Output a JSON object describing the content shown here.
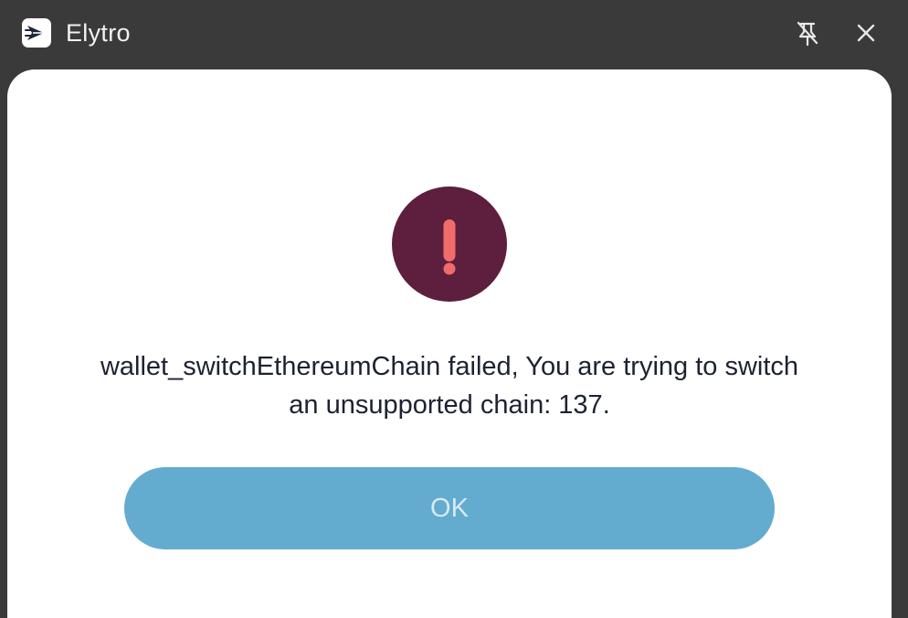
{
  "window": {
    "title": "Elytro",
    "logo_icon": "elytro-logo-icon",
    "pin_icon": "pin-off-icon",
    "close_icon": "close-icon"
  },
  "dialog": {
    "status_icon": "exclamation-icon",
    "message": "wallet_switchEthereumChain failed, You are trying to switch an unsupported chain: 137.",
    "ok_label": "OK"
  },
  "colors": {
    "titlebar_bg": "#3a3a3a",
    "panel_bg": "#ffffff",
    "alert_circle": "#5e1e3e",
    "alert_mark": "#f26b6b",
    "button_bg": "#64abd0",
    "button_text": "#d8e9f3",
    "message_text": "#1d2233"
  }
}
